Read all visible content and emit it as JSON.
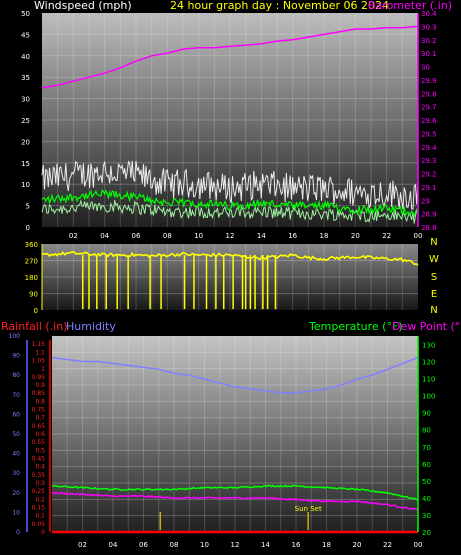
{
  "colors": {
    "wind": "#ffffff",
    "wind_avg": "#00ff00",
    "wind_light": "#a0f0a0",
    "barometer": "#ff00ff",
    "wind_dir": "#ffff00",
    "rain": "#ff0000",
    "humidity": "#8080ff",
    "temperature": "#00ff00",
    "dew_point": "#ff00ff",
    "sun": "#c8b400",
    "title": "#ffff00"
  },
  "header": {
    "windspeed_label": "Windspeed (mph)",
    "title": "24 hour graph day : November 06 2024",
    "barometer_label": "Barometer (.in)"
  },
  "x_ticks": [
    "02",
    "04",
    "06",
    "08",
    "10",
    "12",
    "14",
    "16",
    "18",
    "20",
    "22",
    "00"
  ],
  "chart_data": [
    {
      "type": "line",
      "id": "wind_baro",
      "title": "24 hour graph day : November 06 2024",
      "x_hours_range": [
        0,
        24
      ],
      "left_axis": {
        "label": "Windspeed (mph)",
        "ylim": [
          0,
          50
        ],
        "ticks": [
          "0",
          "5",
          "10",
          "15",
          "20",
          "25",
          "30",
          "35",
          "40",
          "45",
          "50"
        ]
      },
      "right_axis": {
        "label": "Barometer (.in)",
        "ylim": [
          28.8,
          30.4
        ],
        "ticks": [
          "28.8",
          "28.9",
          "29",
          "29.1",
          "29.2",
          "29.3",
          "29.4",
          "29.5",
          "29.6",
          "29.7",
          "29.8",
          "29.9",
          "30",
          "30.1",
          "30.2",
          "30.3",
          "30.4"
        ]
      },
      "series": [
        {
          "name": "Windspeed",
          "axis": "left",
          "x": [
            0,
            2,
            4,
            6,
            8,
            10,
            12,
            14,
            16,
            18,
            20,
            22,
            24
          ],
          "values": [
            9,
            10,
            11,
            10,
            8,
            8,
            7,
            8,
            7,
            7,
            6,
            6,
            5
          ]
        },
        {
          "name": "Barometer",
          "axis": "right",
          "x": [
            0,
            1,
            2,
            3,
            4,
            5,
            6,
            7,
            8,
            9,
            10,
            11,
            12,
            13,
            14,
            15,
            16,
            17,
            18,
            19,
            20,
            21,
            22,
            23,
            24
          ],
          "values": [
            29.84,
            29.86,
            29.89,
            29.92,
            29.95,
            29.99,
            30.04,
            30.08,
            30.1,
            30.13,
            30.14,
            30.14,
            30.15,
            30.16,
            30.17,
            30.19,
            30.2,
            30.22,
            30.24,
            30.26,
            30.28,
            30.28,
            30.29,
            30.29,
            30.3
          ]
        }
      ]
    },
    {
      "type": "scatter",
      "id": "wind_direction",
      "x_hours_range": [
        0,
        24
      ],
      "left_axis": {
        "ylim": [
          0,
          360
        ],
        "ticks": [
          "0",
          "90",
          "180",
          "270",
          "360"
        ]
      },
      "compass_labels": [
        "N",
        "W",
        "S",
        "E",
        "N"
      ],
      "series": [
        {
          "name": "Wind direction",
          "x": [
            0,
            1,
            2,
            3,
            4,
            5,
            6,
            7,
            8,
            9,
            10,
            11,
            12,
            13,
            14,
            15,
            16,
            17,
            18,
            19,
            20,
            21,
            22,
            23,
            24
          ],
          "values": [
            300,
            305,
            310,
            305,
            300,
            300,
            300,
            295,
            300,
            305,
            300,
            300,
            300,
            290,
            285,
            290,
            300,
            285,
            280,
            285,
            290,
            285,
            280,
            275,
            250
          ]
        }
      ]
    },
    {
      "type": "line",
      "id": "temp_hum_rain",
      "x_hours_range": [
        0,
        24
      ],
      "labels": {
        "rainfall": "Rainfall (.in)",
        "humidity": "Humidity",
        "temperature": "Temperature (°F)",
        "dew_point": "Dew Point (°F)"
      },
      "humidity_axis": {
        "ylim": [
          0,
          100
        ],
        "ticks": [
          "0",
          "10",
          "20",
          "30",
          "40",
          "50",
          "60",
          "70",
          "80",
          "90",
          "100"
        ]
      },
      "rain_axis": {
        "ylim": [
          0,
          1.2
        ],
        "ticks": [
          "0",
          "0.05",
          "0.1",
          "0.15",
          "0.2",
          "0.25",
          "0.3",
          "0.35",
          "0.4",
          "0.45",
          "0.5",
          "0.55",
          "0.6",
          "0.65",
          "0.7",
          "0.75",
          "0.8",
          "0.85",
          "0.9",
          "0.95",
          "1",
          "1.05",
          "1.1",
          "1.15"
        ]
      },
      "temp_axis": {
        "ylim": [
          20,
          135
        ],
        "ticks": [
          "20",
          "30",
          "40",
          "50",
          "60",
          "70",
          "80",
          "90",
          "100",
          "110",
          "120",
          "130"
        ]
      },
      "series": [
        {
          "name": "Humidity",
          "axis": "humidity",
          "x": [
            0,
            1,
            2,
            3,
            4,
            5,
            6,
            7,
            8,
            9,
            10,
            11,
            12,
            13,
            14,
            15,
            16,
            17,
            18,
            19,
            20,
            21,
            22,
            23,
            24
          ],
          "values": [
            89,
            88,
            87,
            87,
            86,
            85,
            84,
            83,
            81,
            80,
            78,
            76,
            74,
            73,
            72,
            71,
            71,
            72,
            73,
            75,
            78,
            80,
            83,
            86,
            89
          ]
        },
        {
          "name": "Temperature",
          "axis": "temp",
          "x": [
            0,
            2,
            4,
            6,
            8,
            10,
            12,
            14,
            16,
            18,
            20,
            22,
            24
          ],
          "values": [
            47,
            46,
            45,
            45,
            45,
            46,
            46,
            47,
            47,
            46,
            45,
            43,
            39
          ]
        },
        {
          "name": "Dew Point",
          "axis": "temp",
          "x": [
            0,
            2,
            4,
            6,
            8,
            10,
            12,
            14,
            16,
            18,
            20,
            22,
            24
          ],
          "values": [
            43,
            42,
            41,
            41,
            40,
            40,
            40,
            40,
            39,
            38,
            38,
            36,
            33
          ]
        },
        {
          "name": "Rainfall",
          "axis": "rain",
          "x": [
            0,
            24
          ],
          "values": [
            0,
            0
          ]
        }
      ],
      "annotations": [
        {
          "text": "Sun Set",
          "x_hour": 16.8
        },
        {
          "text": "",
          "x_hour": 7.1
        }
      ]
    }
  ]
}
